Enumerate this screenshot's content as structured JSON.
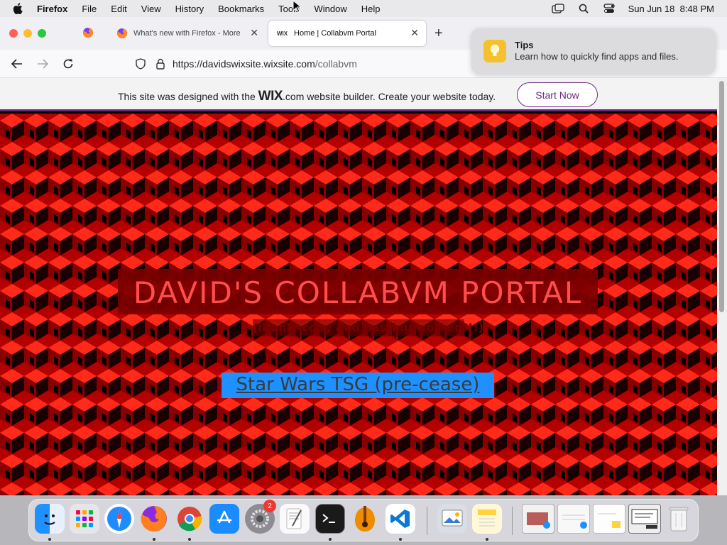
{
  "menubar": {
    "app_name": "Firefox",
    "items": [
      "File",
      "Edit",
      "View",
      "History",
      "Bookmarks",
      "Tools",
      "Window",
      "Help"
    ],
    "clock": "Sun Jun 18  8:48 PM"
  },
  "browser": {
    "tabs": [
      {
        "label": "",
        "icon": "firefox-icon"
      },
      {
        "label": "What's new with Firefox - More",
        "icon": "firefox-icon"
      },
      {
        "label": "Home | Collabvm Portal",
        "icon": "wix-icon"
      }
    ],
    "wix_tab_icon_text": "WIX",
    "url_host": "https://davidswixsite.wixsite.com",
    "url_path": "/collabvm"
  },
  "notification": {
    "title": "Tips",
    "body": "Learn how to quickly find apps and files."
  },
  "wix_banner": {
    "prefix": "This site was designed with the ",
    "logo": "WIX",
    "suffix": ".com website builder. Create your website today.",
    "button": "Start Now"
  },
  "page": {
    "title": "DAVID'S COLLABVM PORTAL",
    "subtitle": "(if only copy and pasting worked!!!)",
    "link": "Star Wars TSG (pre-cease)"
  },
  "dock": {
    "apps": [
      "finder",
      "launchpad",
      "safari",
      "firefox",
      "chrome",
      "app-store",
      "system-preferences",
      "textedit",
      "terminal",
      "instruments",
      "vscode",
      "preview",
      "notes"
    ],
    "settings_badge": "2"
  },
  "colors": {
    "wix_purple": "#6b2b7d",
    "page_red": "#c20000",
    "link_highlight": "#1e90ff"
  }
}
